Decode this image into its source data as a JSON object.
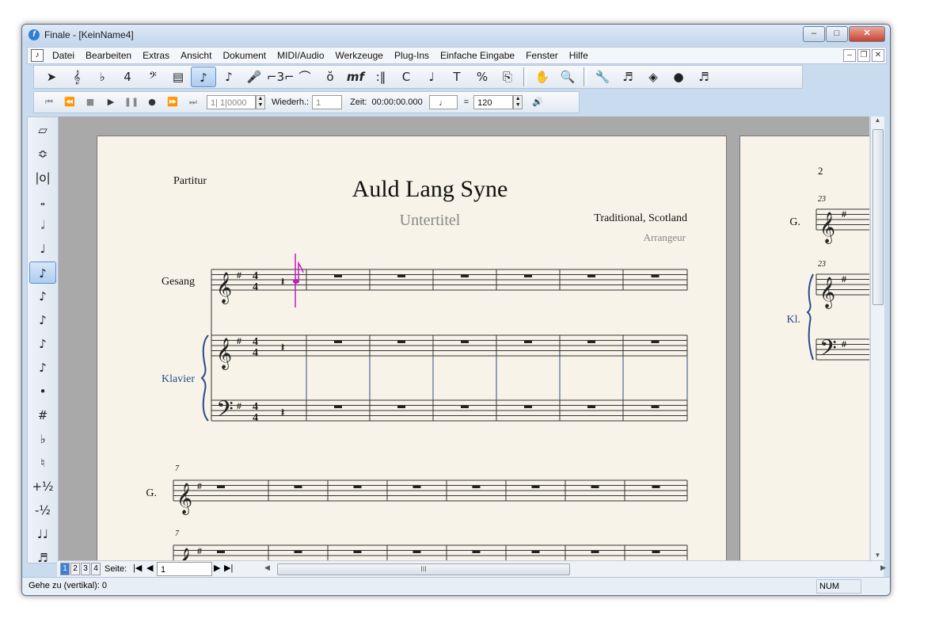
{
  "window": {
    "title": "Finale  - [KeinName4]",
    "buttons": {
      "minimize": "–",
      "maximize": "□",
      "close": "✕"
    }
  },
  "menu": {
    "items": [
      "Datei",
      "Bearbeiten",
      "Extras",
      "Ansicht",
      "Dokument",
      "MIDI/Audio",
      "Werkzeuge",
      "Plug-Ins",
      "Einfache Eingabe",
      "Fenster",
      "Hilfe"
    ]
  },
  "toolbar": {
    "tools": [
      {
        "name": "selection-tool-icon",
        "glyph": "➤"
      },
      {
        "name": "staff-tool-icon",
        "glyph": "𝄞"
      },
      {
        "name": "key-signature-tool-icon",
        "glyph": "♭"
      },
      {
        "name": "time-signature-tool-icon",
        "glyph": "4"
      },
      {
        "name": "clef-tool-icon",
        "glyph": "𝄢"
      },
      {
        "name": "measure-tool-icon",
        "glyph": "▤"
      },
      {
        "name": "simple-entry-tool-icon",
        "glyph": "♪",
        "selected": true
      },
      {
        "name": "speedy-entry-tool-icon",
        "glyph": "♪"
      },
      {
        "name": "hyperscribe-tool-icon",
        "glyph": "🎤"
      },
      {
        "name": "tuplet-tool-icon",
        "glyph": "⌐3⌐"
      },
      {
        "name": "smart-shape-tool-icon",
        "glyph": "⌒"
      },
      {
        "name": "articulation-tool-icon",
        "glyph": "ŏ"
      },
      {
        "name": "expression-tool-icon",
        "glyph": "mf"
      },
      {
        "name": "repeat-tool-icon",
        "glyph": ":‖"
      },
      {
        "name": "chord-tool-icon",
        "glyph": "C"
      },
      {
        "name": "lyrics-tool-icon",
        "glyph": "♩"
      },
      {
        "name": "text-tool-icon",
        "glyph": "T"
      },
      {
        "name": "resize-tool-icon",
        "glyph": "%"
      },
      {
        "name": "page-layout-tool-icon",
        "glyph": "⎘"
      },
      {
        "name": "hand-grabber-icon",
        "glyph": "✋"
      },
      {
        "name": "zoom-tool-icon",
        "glyph": "🔍"
      },
      {
        "name": "special-tools-icon",
        "glyph": "🔧"
      },
      {
        "name": "midi-tool-icon",
        "glyph": "♬"
      },
      {
        "name": "graphics-tool-icon",
        "glyph": "◈"
      },
      {
        "name": "mirror-tool-icon",
        "glyph": "●"
      },
      {
        "name": "ossia-tool-icon",
        "glyph": "♬"
      }
    ]
  },
  "playback": {
    "counter": "1| 1|0000",
    "repeat_label": "Wiederh.:",
    "repeat_value": "1",
    "time_label": "Zeit:",
    "time_value": "00:00:00.000",
    "equals": "=",
    "tempo": "120"
  },
  "palette": {
    "items": [
      {
        "name": "eraser-icon",
        "glyph": "▱"
      },
      {
        "name": "tie-icon",
        "glyph": "≎"
      },
      {
        "name": "double-whole-note-icon",
        "glyph": "|o|"
      },
      {
        "name": "whole-note-icon",
        "glyph": "𝅝"
      },
      {
        "name": "half-note-icon",
        "glyph": "𝅗𝅥"
      },
      {
        "name": "quarter-note-icon",
        "glyph": "♩"
      },
      {
        "name": "eighth-note-icon",
        "glyph": "♪",
        "selected": true
      },
      {
        "name": "sixteenth-note-icon",
        "glyph": "♪"
      },
      {
        "name": "thirty-second-note-icon",
        "glyph": "♪"
      },
      {
        "name": "sixty-fourth-note-icon",
        "glyph": "♪"
      },
      {
        "name": "one-twenty-eighth-note-icon",
        "glyph": "♪"
      },
      {
        "name": "dot-icon",
        "glyph": "•"
      },
      {
        "name": "sharp-icon",
        "glyph": "#"
      },
      {
        "name": "flat-icon",
        "glyph": "♭"
      },
      {
        "name": "natural-icon",
        "glyph": "♮"
      },
      {
        "name": "half-step-up-icon",
        "glyph": "+½"
      },
      {
        "name": "half-step-down-icon",
        "glyph": "-½"
      },
      {
        "name": "tie-notes-icon",
        "glyph": "♩♩"
      },
      {
        "name": "tuplet-notes-icon",
        "glyph": "♬"
      }
    ]
  },
  "score": {
    "label_partitur": "Partitur",
    "title": "Auld Lang Syne",
    "subtitle": "Untertitel",
    "composer": "Traditional, Scotland",
    "arranger": "Arrangeur",
    "staff_gesang": "Gesang",
    "staff_klavier": "Klavier",
    "staff_g": "G.",
    "staff_kl": "Kl.",
    "measure_7": "7",
    "page_number_2": "2",
    "measure_23": "23"
  },
  "bottom": {
    "pages": [
      "1",
      "2",
      "3",
      "4"
    ],
    "seite_label": "Seite:",
    "page_value": "1",
    "scroll_grip": "III"
  },
  "status": {
    "message": "Gehe zu (vertikal): 0",
    "num": "NUM"
  }
}
